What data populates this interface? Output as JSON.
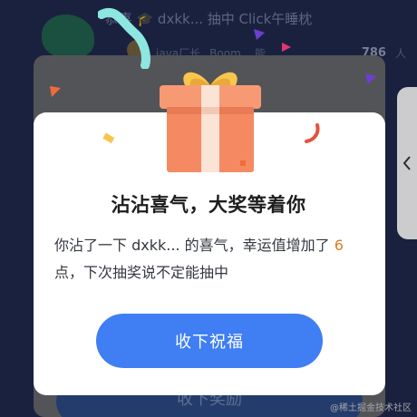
{
  "background": {
    "banner_text": "恭喜 🎓 dxkk... 抽中 Click午睡枕",
    "row_name": "java厂长",
    "row_mid": "Boom... 能",
    "row_count": "786",
    "row_unit": "人",
    "bottom_button": "收下奖励"
  },
  "modal": {
    "title": "沾沾喜气，大奖等着你",
    "desc_prefix": "你沾了一下 dxkk... 的喜气，幸运值增加了 ",
    "luck_value": "6",
    "desc_suffix": " 点，下次抽奖说不定能抽中",
    "accept_button": "收下祝福"
  },
  "watermark": "@稀土掘金技术社区",
  "colors": {
    "accent": "#3f7ef3",
    "highlight": "#e07a1f",
    "gift_box": "#f58a62",
    "ribbon": "#f7c64e"
  },
  "icons": {
    "side_tab": "chevron-left-icon",
    "gift": "gift-box-icon"
  }
}
